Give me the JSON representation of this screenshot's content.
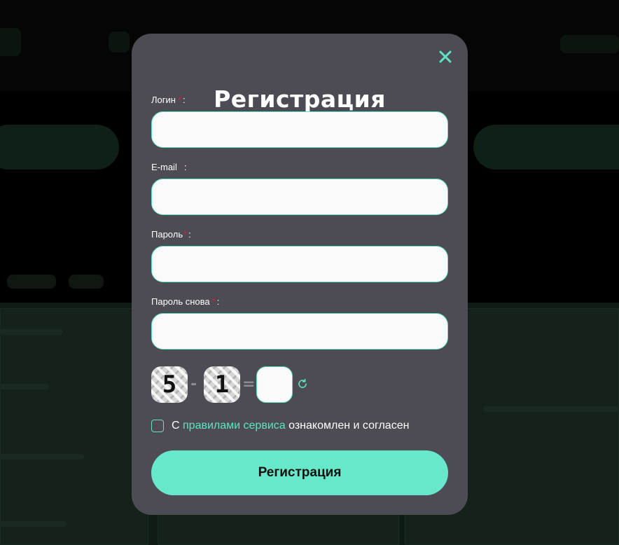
{
  "modal": {
    "title": "Регистрация",
    "close_icon": "close-icon"
  },
  "form": {
    "fields": [
      {
        "label": "Логин",
        "required_mark": "*",
        "colon": ":",
        "value": "",
        "placeholder": ""
      },
      {
        "label": "E-mail",
        "required_mark": "*",
        "colon": ":",
        "value": "",
        "placeholder": ""
      },
      {
        "label": "Пароль",
        "required_mark": "*",
        "colon": ":",
        "value": "",
        "placeholder": ""
      },
      {
        "label": "Пароль снова",
        "required_mark": "*",
        "colon": ":",
        "value": "",
        "placeholder": ""
      }
    ]
  },
  "captcha": {
    "first": "5",
    "operator": "-",
    "second": "1",
    "equals": "=",
    "answer": "",
    "refresh_icon": "refresh-icon"
  },
  "agreement": {
    "prefix": "С",
    "link_text": "правилами сервиса",
    "suffix": "ознакомлен и согласен",
    "checked": false
  },
  "submit_label": "Регистрация",
  "colors": {
    "modal_bg": "#4d4c55",
    "accent": "#68e8cb",
    "required": "#d4203c"
  }
}
